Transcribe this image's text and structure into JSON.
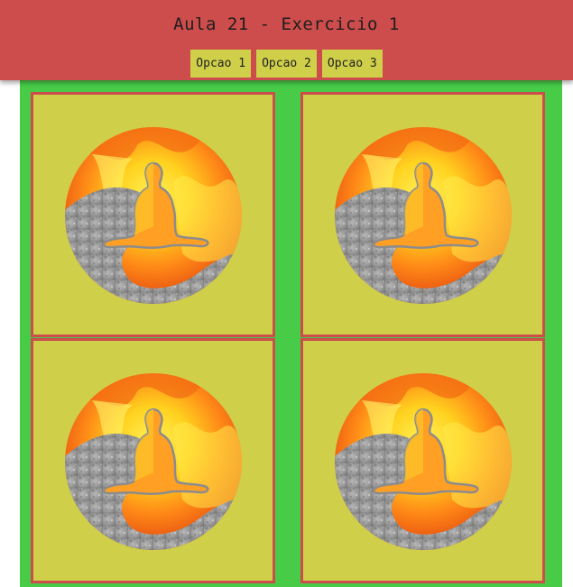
{
  "header": {
    "title": "Aula 21 - Exercicio 1"
  },
  "nav": {
    "items": [
      {
        "label": "Opcao 1"
      },
      {
        "label": "Opcao 2"
      },
      {
        "label": "Opcao 3"
      }
    ]
  },
  "colors": {
    "header_bg": "#cd4c4c",
    "button_bg": "#cfcf4a",
    "main_bg": "#48cc48",
    "card_bg": "#cfcf4a",
    "card_border": "#cd4c4c"
  },
  "gallery": {
    "images": [
      {
        "icon": "fire-stone-meditation-image"
      },
      {
        "icon": "fire-stone-meditation-image"
      },
      {
        "icon": "fire-stone-meditation-image"
      },
      {
        "icon": "fire-stone-meditation-image"
      }
    ]
  }
}
